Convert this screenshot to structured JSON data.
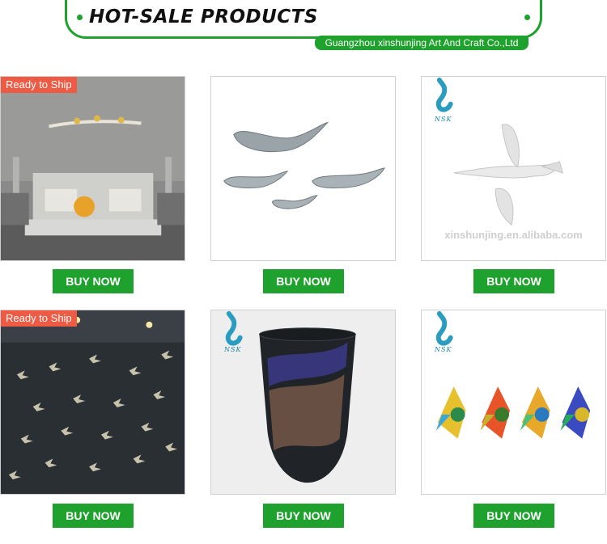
{
  "header": {
    "title": "HOT-SALE PRODUCTS",
    "company": "Guangzhou xinshunjing Art And Craft Co.,Ltd"
  },
  "products": [
    {
      "badge": "Ready to Ship",
      "button": "BUY NOW",
      "image": "bedroom wall bird branch decor"
    },
    {
      "button": "BUY NOW",
      "image": "silver fish wall decor"
    },
    {
      "button": "BUY NOW",
      "image": "clear glass bird",
      "logo": "NSK",
      "watermark": "xinshunjing.en.alibaba.com"
    },
    {
      "badge": "Ready to Ship",
      "button": "BUY NOW",
      "image": "hanging glass birds installation"
    },
    {
      "button": "BUY NOW",
      "image": "dark art glass vase",
      "logo": "NSK"
    },
    {
      "button": "BUY NOW",
      "image": "colorful glass fish figurines",
      "logo": "NSK"
    }
  ],
  "colors": {
    "accent": "#1fa12e",
    "badge": "#ee5b45"
  }
}
